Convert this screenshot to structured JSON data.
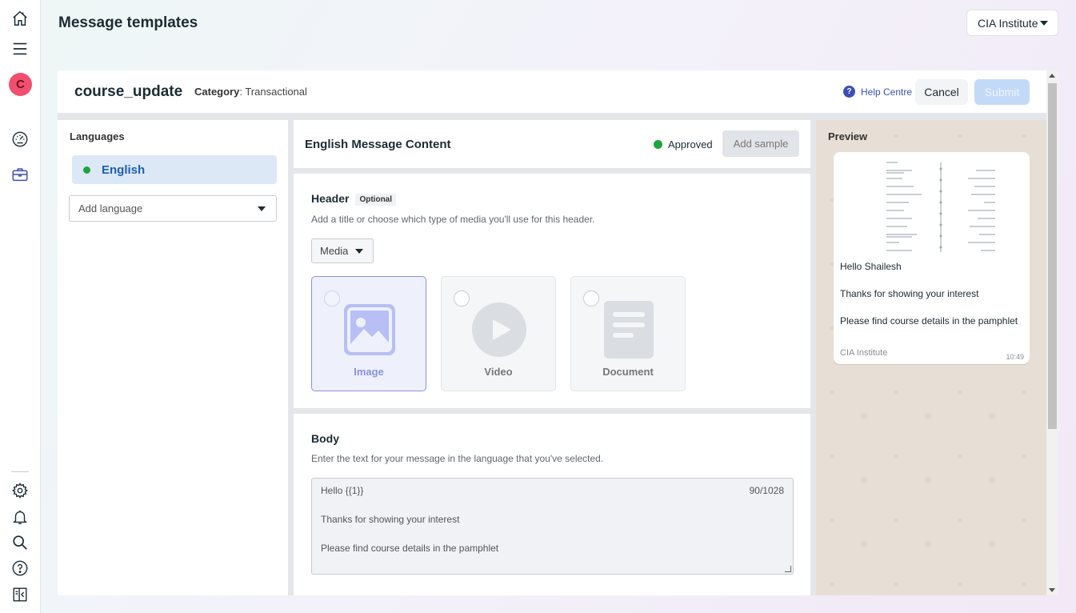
{
  "page": {
    "title": "Message templates"
  },
  "account": {
    "name": "CIA Institute"
  },
  "rail": {
    "avatar_letter": "C"
  },
  "template": {
    "name": "course_update",
    "category_label": "Category",
    "category_value": ": Transactional",
    "help_label": "Help Centre",
    "cancel_label": "Cancel",
    "submit_label": "Submit"
  },
  "languages": {
    "title": "Languages",
    "items": [
      {
        "label": "English",
        "status_color": "#1fa33f"
      }
    ],
    "add_placeholder": "Add language"
  },
  "content": {
    "title": "English Message Content",
    "status": "Approved",
    "add_sample_label": "Add sample",
    "header": {
      "title": "Header",
      "badge": "Optional",
      "description": "Add a title or choose which type of media you'll use for this header.",
      "media_select": "Media",
      "options": [
        {
          "label": "Image",
          "selected": true
        },
        {
          "label": "Video",
          "selected": false
        },
        {
          "label": "Document",
          "selected": false
        }
      ]
    },
    "body": {
      "title": "Body",
      "description": "Enter the text for your message in the language that you've selected.",
      "lines": [
        "Hello {{1}}",
        "Thanks for showing your interest",
        "Please find course details in the pamphlet"
      ],
      "counter": "90/1028"
    }
  },
  "preview": {
    "title": "Preview",
    "lines": [
      "Hello Shailesh",
      "Thanks for showing your interest",
      "Please find course details in the pamphlet"
    ],
    "footer": "CIA Institute",
    "time": "10:49"
  },
  "colors": {
    "accent": "#1f5fae",
    "approved": "#1fa33f",
    "submit_disabled": "#c2daf7"
  }
}
